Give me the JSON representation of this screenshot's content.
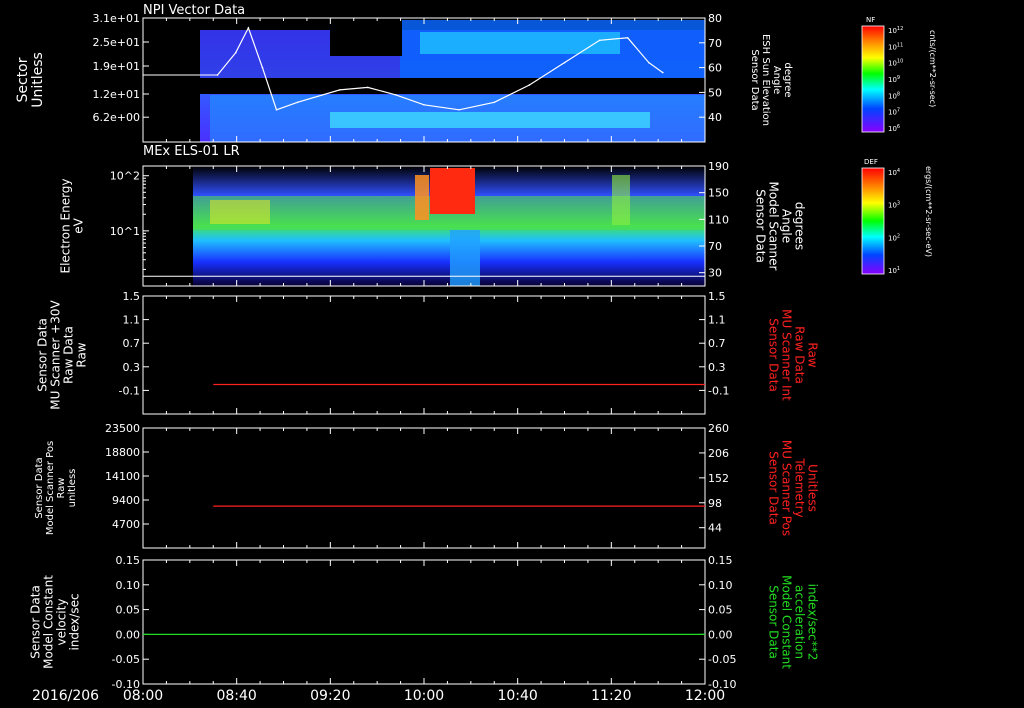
{
  "time_axis": {
    "date_label": "2016/206",
    "ticks": [
      "08:00",
      "08:40",
      "09:20",
      "10:00",
      "10:40",
      "11:20",
      "12:00"
    ],
    "range_hours": [
      8.0,
      12.0
    ]
  },
  "colors": {
    "background": "#000000",
    "axis": "#ffffff",
    "red_trace": "#ff2020",
    "green_trace": "#22dd22"
  },
  "chart_data": [
    {
      "type": "heatmap",
      "title": "NPI Vector Data",
      "ylabel": [
        "Sector",
        "Unitless"
      ],
      "yticks": [
        "3.1e+01",
        "2.5e+01",
        "1.9e+01",
        "1.2e+01",
        "6.2e+00"
      ],
      "ytick_values": [
        31,
        25,
        19,
        12,
        6.2
      ],
      "ylim": [
        0,
        31
      ],
      "data_start": 8.53,
      "overlay": {
        "type": "line",
        "name": "ESH Sun Elevation Angle",
        "ylabel": [
          "Sensor Data",
          "ESH Sun Elevation",
          "Angle",
          "degree"
        ],
        "yticks": [
          80,
          70,
          60,
          50,
          40
        ],
        "ylim": [
          30,
          80
        ],
        "x": [
          8.53,
          8.66,
          8.75,
          8.85,
          8.95,
          9.1,
          9.4,
          9.6,
          9.8,
          10.0,
          10.25,
          10.5,
          10.75,
          11.0,
          11.25,
          11.45,
          11.6,
          11.7
        ],
        "y": [
          57,
          66,
          76,
          60,
          43,
          46,
          51,
          52,
          49,
          45,
          43,
          46,
          53,
          62,
          71,
          72,
          62,
          58
        ]
      },
      "colorbar": {
        "label_top": "NF",
        "title": "cnts/(cm**2-sr-sec)",
        "ticks": [
          "10^12",
          "10^11",
          "10^10",
          "10^9",
          "10^8",
          "10^7",
          "10^6"
        ]
      }
    },
    {
      "type": "heatmap",
      "title": "MEx ELS-01 LR",
      "ylabel": [
        "Electron Energy",
        "eV"
      ],
      "yticks": [
        "10^2",
        "10^1"
      ],
      "log_scale": true,
      "ylim": [
        1,
        150
      ],
      "data_start": 8.4,
      "right_axis": {
        "ylabel": [
          "Sensor Data",
          "Model Scanner",
          "Angle",
          "degrees"
        ],
        "yticks": [
          190,
          150,
          110,
          70,
          30
        ],
        "ylim": [
          10,
          190
        ]
      },
      "colorbar": {
        "label_top": "DEF",
        "title": "ergs/(cm**2-sr-sec-eV)",
        "ticks": [
          "10^4",
          "10^3",
          "10^2",
          "10^1"
        ]
      }
    },
    {
      "type": "line",
      "ylabel": [
        "Sensor Data",
        "MU Scanner +30V",
        "Raw Data",
        "Raw"
      ],
      "yticks": [
        "1.5",
        "1.1",
        "0.7",
        "0.3",
        "-0.1"
      ],
      "ylim": [
        -0.5,
        1.5
      ],
      "right_axis": {
        "ylabel": [
          "Sensor Data",
          "MU Scanner Int",
          "Raw Data",
          "Raw"
        ],
        "yticks": [
          "1.5",
          "1.1",
          "0.7",
          "0.3",
          "-0.1"
        ],
        "ylim": [
          -0.5,
          1.5
        ],
        "color": "#ff2020"
      },
      "series": [
        {
          "x": [
            8.5,
            12.0
          ],
          "y": [
            0.0,
            0.0
          ],
          "color": "#ff2020"
        }
      ]
    },
    {
      "type": "line",
      "ylabel": [
        "Sensor Data",
        "Model Scanner Pos",
        "Raw",
        "unitless"
      ],
      "yticks": [
        "23500",
        "18800",
        "14100",
        "9400",
        "4700"
      ],
      "ylim": [
        0,
        23500
      ],
      "right_axis": {
        "ylabel": [
          "Sensor Data",
          "MU Scanner Pos",
          "Telemetry",
          "Unitless"
        ],
        "yticks": [
          "260",
          "206",
          "152",
          "98",
          "44"
        ],
        "ylim": [
          0,
          260
        ],
        "color": "#ff2020"
      },
      "series": [
        {
          "x": [
            8.5,
            12.0
          ],
          "y": [
            8200,
            8200
          ],
          "color": "#ff2020"
        }
      ]
    },
    {
      "type": "line",
      "ylabel": [
        "Sensor Data",
        "Model Constant",
        "velocity",
        "index/sec"
      ],
      "yticks": [
        "0.15",
        "0.10",
        "0.05",
        "0.00",
        "-0.05",
        "-0.10"
      ],
      "ylim": [
        -0.1,
        0.15
      ],
      "right_axis": {
        "ylabel": [
          "Sensor Data",
          "Model Constant",
          "acceleration",
          "index/sec**2"
        ],
        "yticks": [
          "0.15",
          "0.10",
          "0.05",
          "0.00",
          "-0.05",
          "-0.10"
        ],
        "ylim": [
          -0.1,
          0.15
        ],
        "color": "#22dd22"
      },
      "series": [
        {
          "x": [
            8.0,
            12.0
          ],
          "y": [
            0.0,
            0.0
          ],
          "color": "#22dd22"
        }
      ]
    }
  ]
}
